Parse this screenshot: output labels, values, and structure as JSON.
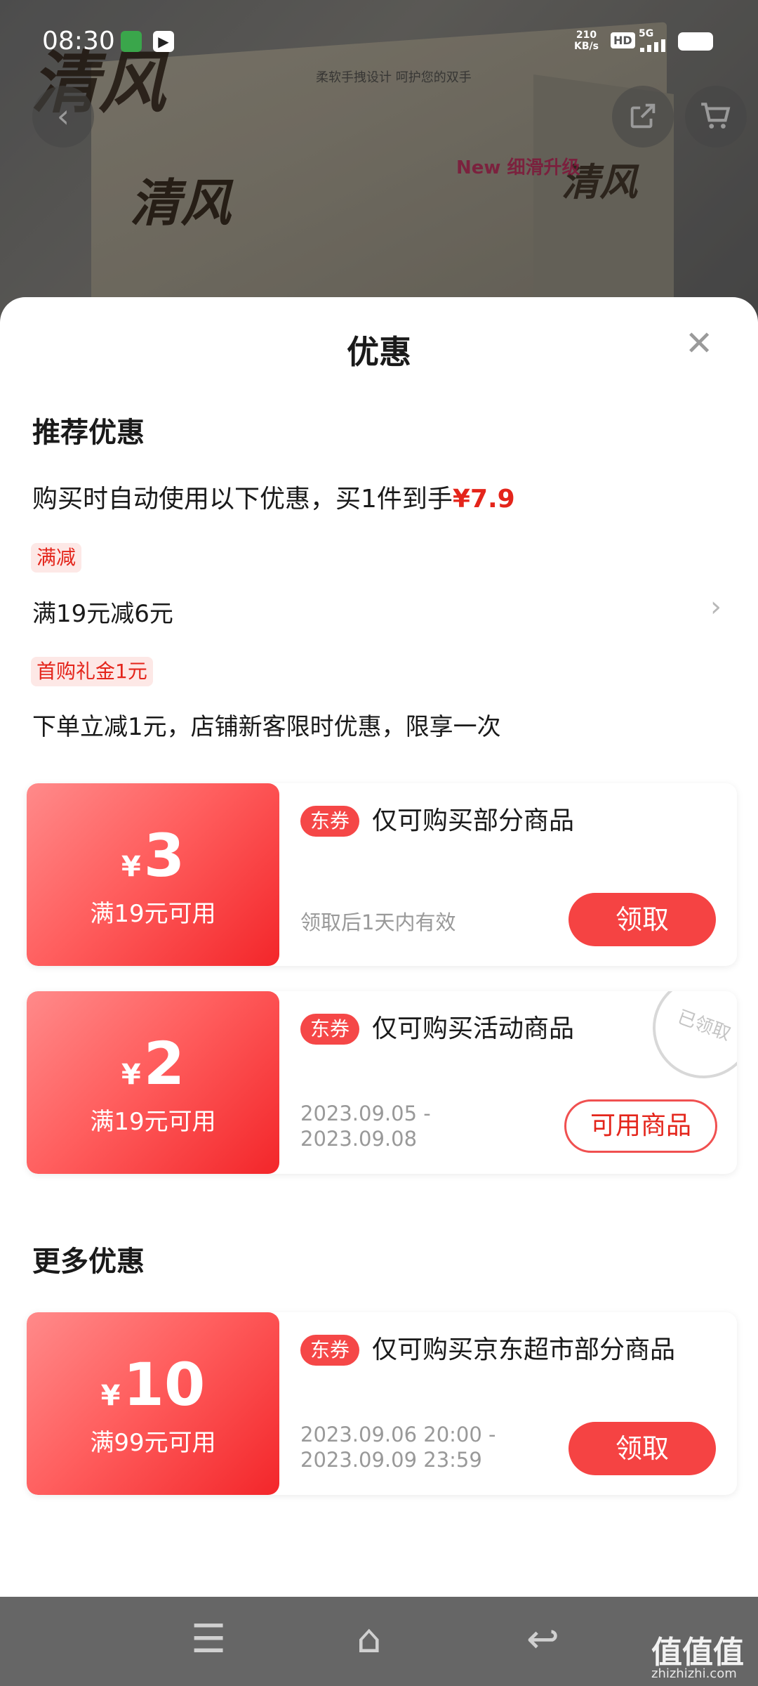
{
  "status_bar": {
    "time": "08:30",
    "net_speed": "210",
    "net_unit": "KB/s",
    "hd": "HD",
    "signal": "5G"
  },
  "product_bg": {
    "brand": "清风",
    "slogan": "柔软手拽设计 呵护您的双手",
    "new_badge": "New 细滑升级"
  },
  "icons": {
    "back": "chevron-left-icon",
    "share": "share-icon",
    "cart": "cart-icon",
    "close": "close-icon"
  },
  "sheet": {
    "title": "优惠",
    "recommended_heading": "推荐优惠",
    "auto_prefix": "购买时自动使用以下优惠，买1件到手",
    "auto_price": "¥7.9",
    "promos": [
      {
        "tag": "满减",
        "text": "满19元减6元"
      },
      {
        "tag": "首购礼金1元",
        "text": "下单立减1元，店铺新客限时优惠，限享一次"
      }
    ],
    "more_heading": "更多优惠"
  },
  "coupons": [
    {
      "yen": "¥",
      "amount": "3",
      "condition": "满19元可用",
      "badge": "东券",
      "desc": "仅可购买部分商品",
      "valid_line1": "领取后1天内有效",
      "valid_line2": "",
      "button": "领取"
    },
    {
      "yen": "¥",
      "amount": "2",
      "condition": "满19元可用",
      "badge": "东券",
      "desc": "仅可购买活动商品",
      "valid_line1": "2023.09.05 -",
      "valid_line2": "2023.09.08",
      "button": "可用商品",
      "stamp": "已领取"
    },
    {
      "yen": "¥",
      "amount": "10",
      "condition": "满99元可用",
      "badge": "东券",
      "desc": "仅可购买京东超市部分商品",
      "valid_line1": "2023.09.06 20:00 -",
      "valid_line2": "2023.09.09 23:59",
      "button": "领取"
    }
  ],
  "watermark": {
    "main": "值值值",
    "sub": "zhizhizhi.com"
  }
}
